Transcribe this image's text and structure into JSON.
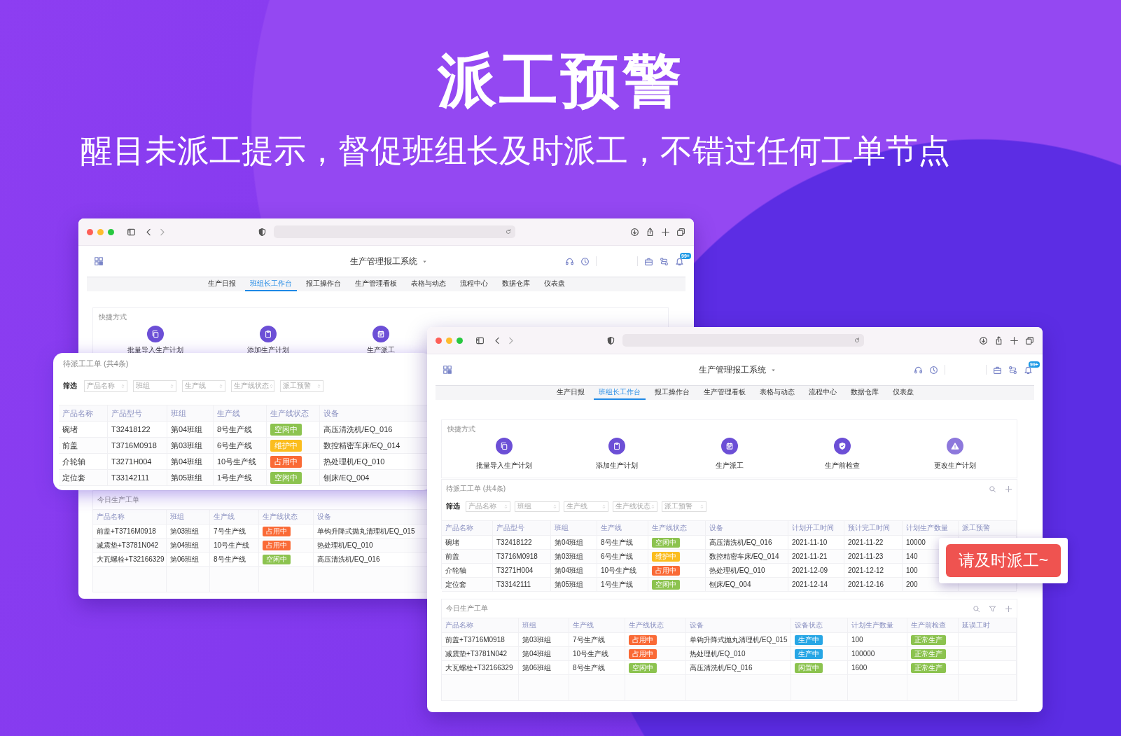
{
  "title": "派工预警",
  "subtitle": "醒目未派工提示，督促班组长及时派工，不错过任何工单节点",
  "back_window": {
    "app_title": "生产管理报工系统",
    "badge": "99+",
    "nav": [
      {
        "label": "生产日报",
        "selected": false
      },
      {
        "label": "班组长工作台",
        "selected": true
      },
      {
        "label": "报工操作台",
        "selected": false
      },
      {
        "label": "生产管理看板",
        "selected": false
      },
      {
        "label": "表格与动态",
        "selected": false
      },
      {
        "label": "流程中心",
        "selected": false
      },
      {
        "label": "数据仓库",
        "selected": false
      },
      {
        "label": "仪表盘",
        "selected": false
      }
    ],
    "shortcuts_title": "快捷方式",
    "shortcuts": [
      {
        "label": "批量导入生产计划"
      },
      {
        "label": "添加生产计划"
      },
      {
        "label": "生产派工"
      }
    ],
    "today_orders": {
      "title": "今日生产工单",
      "columns": [
        "产品名称",
        "班组",
        "生产线",
        "生产线状态",
        "设备"
      ],
      "rows": [
        [
          "前盖+T3716M0918",
          "第03班组",
          "7号生产线",
          {
            "tag": "占用中",
            "color": "#fa6a36"
          },
          "单钩升降式抛丸清理机/EQ_015"
        ],
        [
          "减震垫+T3781N042",
          "第04班组",
          "10号生产线",
          {
            "tag": "占用中",
            "color": "#fa6a36"
          },
          "热处理机/EQ_010"
        ],
        [
          "大瓦螺栓+T32166329",
          "第06班组",
          "8号生产线",
          {
            "tag": "空闲中",
            "color": "#8cc34f"
          },
          "高压清洗机/EQ_016"
        ]
      ]
    }
  },
  "popup": {
    "title": "待派工工单 (共4条)",
    "filter_label": "筛选",
    "filters": [
      {
        "placeholder": "产品名称"
      },
      {
        "placeholder": "班组"
      },
      {
        "placeholder": "生产线"
      },
      {
        "placeholder": "生产线状态"
      },
      {
        "placeholder": "派工预警"
      }
    ],
    "columns": [
      "产品名称",
      "产品型号",
      "班组",
      "生产线",
      "生产线状态",
      "设备"
    ],
    "rows": [
      [
        "碗堵",
        "T32418122",
        "第04班组",
        "8号生产线",
        {
          "tag": "空闲中",
          "color": "#8cc34f"
        },
        "高压清洗机/EQ_016"
      ],
      [
        "前盖",
        "T3716M0918",
        "第03班组",
        "6号生产线",
        {
          "tag": "维护中",
          "color": "#fbbd1e"
        },
        "数控精密车床/EQ_014"
      ],
      [
        "介轮轴",
        "T3271H004",
        "第04班组",
        "10号生产线",
        {
          "tag": "占用中",
          "color": "#fa6a36"
        },
        "热处理机/EQ_010"
      ],
      [
        "定位套",
        "T33142111",
        "第05班组",
        "1号生产线",
        {
          "tag": "空闲中",
          "color": "#8cc34f"
        },
        "刨床/EQ_004"
      ]
    ]
  },
  "front_window": {
    "app_title": "生产管理报工系统",
    "badge": "99+",
    "nav": [
      {
        "label": "生产日报",
        "selected": false
      },
      {
        "label": "班组长工作台",
        "selected": true
      },
      {
        "label": "报工操作台",
        "selected": false
      },
      {
        "label": "生产管理看板",
        "selected": false
      },
      {
        "label": "表格与动态",
        "selected": false
      },
      {
        "label": "流程中心",
        "selected": false
      },
      {
        "label": "数据仓库",
        "selected": false
      },
      {
        "label": "仪表盘",
        "selected": false
      }
    ],
    "shortcuts_title": "快捷方式",
    "shortcuts": [
      {
        "label": "批量导入生产计划"
      },
      {
        "label": "添加生产计划"
      },
      {
        "label": "生产派工"
      },
      {
        "label": "生产前检查"
      },
      {
        "label": "更改生产计划"
      }
    ],
    "pending_orders": {
      "title": "待派工工单 (共4条)",
      "filter_label": "筛选",
      "filters": [
        {
          "placeholder": "产品名称"
        },
        {
          "placeholder": "班组"
        },
        {
          "placeholder": "生产线"
        },
        {
          "placeholder": "生产线状态"
        },
        {
          "placeholder": "派工预警"
        }
      ],
      "columns": [
        "产品名称",
        "产品型号",
        "班组",
        "生产线",
        "生产线状态",
        "设备",
        "计划开工时间",
        "预计完工时间",
        "计划生产数量",
        "派工预警"
      ],
      "rows": [
        [
          "碗堵",
          "T32418122",
          "第04班组",
          "8号生产线",
          {
            "tag": "空闲中",
            "color": "#8cc34f"
          },
          "高压清洗机/EQ_016",
          "2021-11-10",
          "2021-11-22",
          "10000"
        ],
        [
          "前盖",
          "T3716M0918",
          "第03班组",
          "6号生产线",
          {
            "tag": "维护中",
            "color": "#fbbd1e"
          },
          "数控精密车床/EQ_014",
          "2021-11-21",
          "2021-11-23",
          "140"
        ],
        [
          "介轮轴",
          "T3271H004",
          "第04班组",
          "10号生产线",
          {
            "tag": "占用中",
            "color": "#fa6a36"
          },
          "热处理机/EQ_010",
          "2021-12-09",
          "2021-12-12",
          "100"
        ],
        [
          "定位套",
          "T33142111",
          "第05班组",
          "1号生产线",
          {
            "tag": "空闲中",
            "color": "#8cc34f"
          },
          "刨床/EQ_004",
          "2021-12-14",
          "2021-12-16",
          "200"
        ]
      ]
    },
    "today_orders": {
      "title": "今日生产工单",
      "columns": [
        "产品名称",
        "班组",
        "生产线",
        "生产线状态",
        "设备",
        "设备状态",
        "计划生产数量",
        "生产前检查",
        "延误工时"
      ],
      "rows": [
        [
          "前盖+T3716M0918",
          "第03班组",
          "7号生产线",
          {
            "tag": "占用中",
            "color": "#fa6a36"
          },
          "单钩升降式抛丸清理机/EQ_015",
          {
            "tag": "生产中",
            "color": "#27a6e5"
          },
          "100",
          {
            "tag": "正常生产",
            "color": "#8cc34f"
          }
        ],
        [
          "减震垫+T3781N042",
          "第04班组",
          "10号生产线",
          {
            "tag": "占用中",
            "color": "#fa6a36"
          },
          "热处理机/EQ_010",
          {
            "tag": "生产中",
            "color": "#27a6e5"
          },
          "100000",
          {
            "tag": "正常生产",
            "color": "#8cc34f"
          }
        ],
        [
          "大瓦螺栓+T32166329",
          "第06班组",
          "8号生产线",
          {
            "tag": "空闲中",
            "color": "#8cc34f"
          },
          "高压清洗机/EQ_016",
          {
            "tag": "闲置中",
            "color": "#8cc34f"
          },
          "1600",
          {
            "tag": "正常生产",
            "color": "#8cc34f"
          }
        ]
      ]
    }
  },
  "toast": "请及时派工~"
}
